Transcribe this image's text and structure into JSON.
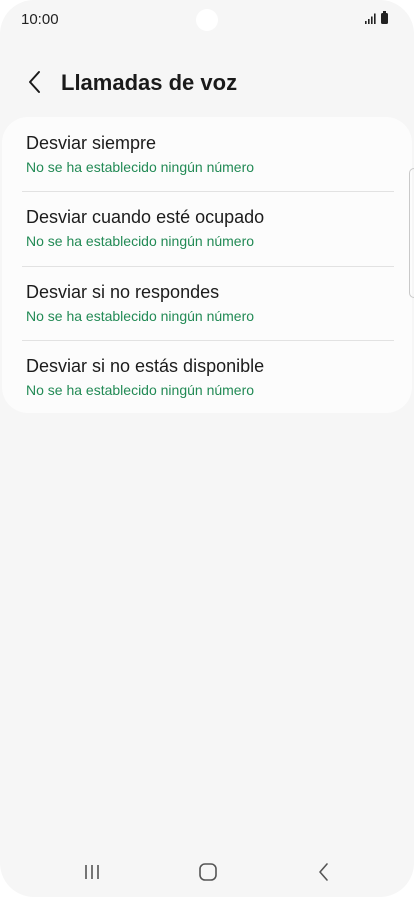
{
  "status_bar": {
    "time": "10:00",
    "icons": [
      "signal-icon",
      "battery-icon"
    ]
  },
  "header": {
    "back_icon": "chevron-left-icon",
    "title": "Llamadas de voz"
  },
  "forwarding_options": [
    {
      "label": "Desviar siempre",
      "status": "No se ha establecido ningún número"
    },
    {
      "label": "Desviar cuando esté ocupado",
      "status": "No se ha establecido ningún número"
    },
    {
      "label": "Desviar si no respondes",
      "status": "No se ha establecido ningún número"
    },
    {
      "label": "Desviar si no estás disponible",
      "status": "No se ha establecido ningún número"
    }
  ],
  "nav_bar": {
    "icons": [
      "recent-apps-icon",
      "home-icon",
      "back-icon"
    ]
  },
  "colors": {
    "background": "#f6f6f6",
    "card": "#fcfcfc",
    "accent": "#228a55",
    "text": "#1c1c1c"
  }
}
